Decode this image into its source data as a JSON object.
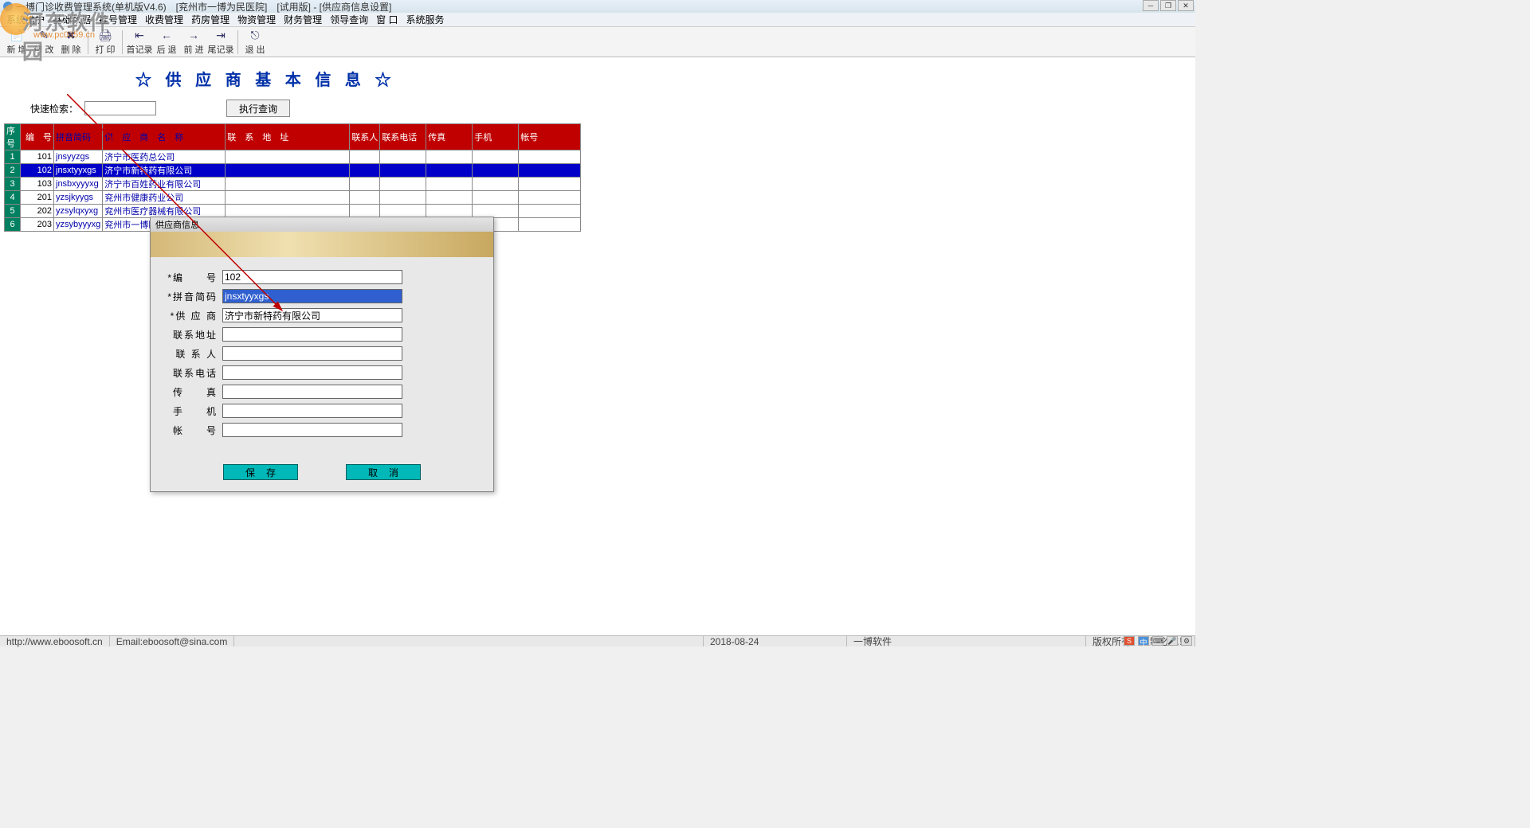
{
  "title": "一博门诊收费管理系统(单机版V4.6)　[兖州市一博为民医院]　[试用版] - [供应商信息设置]",
  "menus": [
    "系统维护",
    "基础数据",
    "挂号管理",
    "收费管理",
    "药房管理",
    "物资管理",
    "财务管理",
    "领导查询",
    "窗 口",
    "系统服务"
  ],
  "toolbar": [
    {
      "l": "新 增",
      "i": "📄"
    },
    {
      "l": "修 改",
      "i": "✎"
    },
    {
      "l": "删 除",
      "i": "✖"
    },
    {
      "sep": true
    },
    {
      "l": "打 印",
      "i": "🖨"
    },
    {
      "sep": true
    },
    {
      "l": "首记录",
      "i": "⇤"
    },
    {
      "l": "后 退",
      "i": "←"
    },
    {
      "l": "前 进",
      "i": "→"
    },
    {
      "l": "尾记录",
      "i": "⇥"
    },
    {
      "sep": true
    },
    {
      "l": "退 出",
      "i": "⎋"
    }
  ],
  "page_title": "☆ 供 应 商 基 本 信 息 ☆",
  "search_label": "快速检索：",
  "query_btn": "执行查询",
  "columns": [
    "序号",
    "编　号",
    "拼音简码",
    "供　应　商　名　称",
    "联　系　地　址",
    "联系人",
    "联系电话",
    "传真",
    "手机",
    "帐号"
  ],
  "rows": [
    {
      "n": "1",
      "code": "101",
      "py": "jnsyyzgs",
      "name": "济宁市医药总公司"
    },
    {
      "n": "2",
      "code": "102",
      "py": "jnsxtyyxgs",
      "name": "济宁市新特药有限公司",
      "sel": true
    },
    {
      "n": "3",
      "code": "103",
      "py": "jnsbxyyyxg",
      "name": "济宁市百姓药业有限公司"
    },
    {
      "n": "4",
      "code": "201",
      "py": "yzsjkyygs",
      "name": "兖州市健康药业公司"
    },
    {
      "n": "5",
      "code": "202",
      "py": "yzsylqxyxg",
      "name": "兖州市医疗器械有限公司"
    },
    {
      "n": "6",
      "code": "203",
      "py": "yzsybyyyxg",
      "name": "兖州市一博医药有限公司"
    }
  ],
  "dialog": {
    "title": "供应商信息",
    "fields": [
      {
        "label": "*编　　号",
        "val": "102"
      },
      {
        "label": "*拼音简码",
        "val": "jnsxtyyxgs",
        "sel": true
      },
      {
        "label": "*供 应 商",
        "val": "济宁市新特药有限公司"
      },
      {
        "label": "联系地址",
        "val": ""
      },
      {
        "label": "联 系 人",
        "val": ""
      },
      {
        "label": "联系电话",
        "val": ""
      },
      {
        "label": "传　　真",
        "val": ""
      },
      {
        "label": "手　　机",
        "val": ""
      },
      {
        "label": "帐　　号",
        "val": ""
      }
    ],
    "save": "保存",
    "cancel": "取消"
  },
  "status": {
    "url": "http://www.eboosoft.cn",
    "email": "Email:eboosoft@sina.com",
    "date": "2018-08-24",
    "company": "一博软件",
    "copyright": "版权所有　复制必究！"
  },
  "watermark": {
    "big": "河东软件园",
    "sm": "www.pc0359.cn"
  },
  "ime": "中"
}
